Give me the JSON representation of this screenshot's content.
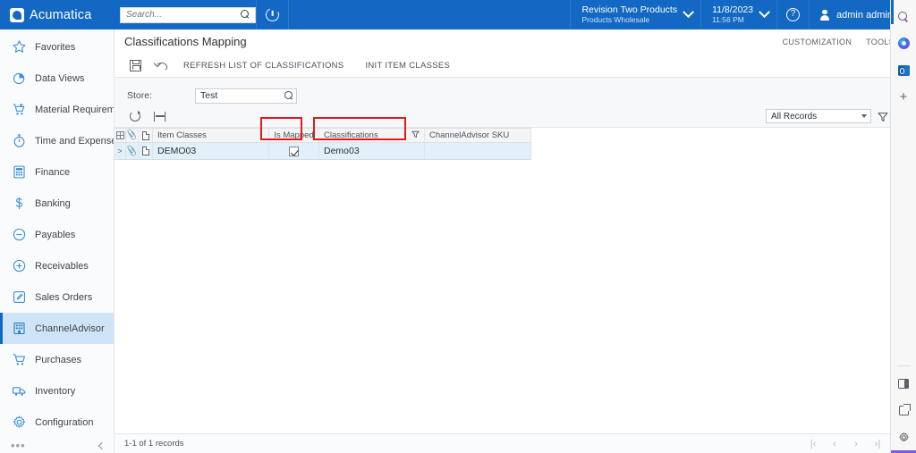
{
  "topbar": {
    "brand": "Acumatica",
    "search_placeholder": "Search...",
    "recent_icon": "recent-history-icon",
    "company": {
      "name": "Revision Two Products",
      "branch": "Products Wholesale"
    },
    "datetime": {
      "date": "11/8/2023",
      "time": "11:56 PM"
    },
    "help_glyph": "?",
    "user": "admin admin"
  },
  "sidebar": {
    "items": [
      {
        "label": "Favorites",
        "icon": "star-icon",
        "active": false
      },
      {
        "label": "Data Views",
        "icon": "pie-chart-icon",
        "active": false
      },
      {
        "label": "Material Requirem...",
        "icon": "cart-plus-icon",
        "active": false
      },
      {
        "label": "Time and Expenses",
        "icon": "stopwatch-icon",
        "active": false
      },
      {
        "label": "Finance",
        "icon": "calculator-icon",
        "active": false
      },
      {
        "label": "Banking",
        "icon": "dollar-icon",
        "active": false
      },
      {
        "label": "Payables",
        "icon": "minus-circle-icon",
        "active": false
      },
      {
        "label": "Receivables",
        "icon": "plus-circle-icon",
        "active": false
      },
      {
        "label": "Sales Orders",
        "icon": "pencil-square-icon",
        "active": false
      },
      {
        "label": "ChannelAdvisor",
        "icon": "building-icon",
        "active": true
      },
      {
        "label": "Purchases",
        "icon": "shopping-cart-icon",
        "active": false
      },
      {
        "label": "Inventory",
        "icon": "truck-icon",
        "active": false
      },
      {
        "label": "Configuration",
        "icon": "gear-icon",
        "active": false
      }
    ],
    "more_label": "•••",
    "collapse_icon": "chevron-left-icon"
  },
  "page": {
    "title": "Classifications Mapping",
    "customization_label": "CUSTOMIZATION",
    "tools_label": "TOOLS",
    "toolbar": {
      "save_icon": "save-icon",
      "undo_icon": "undo-icon",
      "refresh_classifications_label": "REFRESH LIST OF CLASSIFICATIONS",
      "init_item_classes_label": "INIT ITEM CLASSES"
    },
    "form": {
      "store_label": "Store:",
      "store_value": "Test",
      "store_lookup_icon": "magnifier-icon"
    },
    "grid_tools": {
      "refresh_icon": "refresh-icon",
      "fit_columns_icon": "fit-columns-icon",
      "records_filter_value": "All Records",
      "filter_icon": "funnel-icon"
    }
  },
  "grid": {
    "columns": [
      {
        "key": "selector",
        "label": "",
        "icon": "grid-selector-icon"
      },
      {
        "key": "files",
        "label": "",
        "icon": "paperclip-icon"
      },
      {
        "key": "notes",
        "label": "",
        "icon": "note-icon"
      },
      {
        "key": "item_classes",
        "label": "Item Classes"
      },
      {
        "key": "is_mapped",
        "label": "Is Mapped"
      },
      {
        "key": "classifications",
        "label": "Classifications",
        "icon": "funnel-icon"
      },
      {
        "key": "ca_sku",
        "label": "ChannelAdvisor SKU"
      }
    ],
    "rows": [
      {
        "expander": ">",
        "files_icon": "paperclip-icon",
        "notes_icon": "note-icon",
        "item_classes": "DEMO03",
        "is_mapped": true,
        "classifications": "Demo03",
        "ca_sku": "",
        "selected": true
      }
    ]
  },
  "annotations": {
    "highlight_color": "#e01b1b",
    "boxes": [
      "is-mapped-cell",
      "classifications-cell"
    ]
  },
  "statusbar": {
    "record_count": "1-1 of 1 records",
    "pager": [
      {
        "glyph": "|‹",
        "name": "first-page-button"
      },
      {
        "glyph": "‹",
        "name": "previous-page-button"
      },
      {
        "glyph": "›",
        "name": "next-page-button"
      },
      {
        "glyph": "›|",
        "name": "last-page-button"
      }
    ]
  },
  "browser_rail": {
    "top_icons": [
      "search-icon",
      "copilot-icon",
      "outlook-icon",
      "add-icon"
    ],
    "bottom_icons": [
      "sidebar-panel-icon",
      "open-in-new-icon",
      "settings-gear-icon"
    ],
    "add_glyph": "+"
  }
}
